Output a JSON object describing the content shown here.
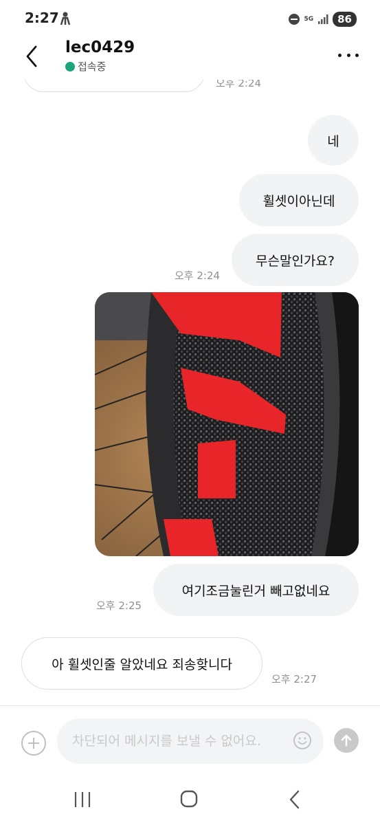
{
  "status_bar": {
    "time": "2:27",
    "network": "5G",
    "battery": "86"
  },
  "header": {
    "title": "lec0429",
    "status": "접속중",
    "status_color": "#1ba57d"
  },
  "messages": [
    {
      "side": "outgoing",
      "text": "네"
    },
    {
      "side": "outgoing",
      "text": "휠셋이아닌데"
    },
    {
      "side": "outgoing",
      "text": "무슨말인가요?",
      "time": "오후 2:24"
    },
    {
      "side": "outgoing",
      "type": "image"
    },
    {
      "side": "outgoing",
      "text": "여기조금눌린거 빼고없네요",
      "time": "오후 2:25"
    },
    {
      "side": "incoming",
      "text": "아 휠셋인줄 알았네요 죄송핮니다",
      "time": "오후 2:27"
    }
  ],
  "clipped_time": "오후 2:24",
  "input": {
    "placeholder": "차단되어 메시지를 보낼 수 없어요."
  },
  "icons": [
    "person-icon",
    "dnd-icon",
    "signal-icon",
    "back-arrow-icon",
    "more-icon",
    "add-icon",
    "emoji-icon",
    "send-arrow-icon",
    "recents-icon",
    "home-icon",
    "nav-back-icon"
  ],
  "colors": {
    "outgoing_bubble": "#f2f3f5",
    "incoming_bubble": "#ffffff",
    "online": "#1ba57d",
    "wheel_red": "#e8262a"
  }
}
